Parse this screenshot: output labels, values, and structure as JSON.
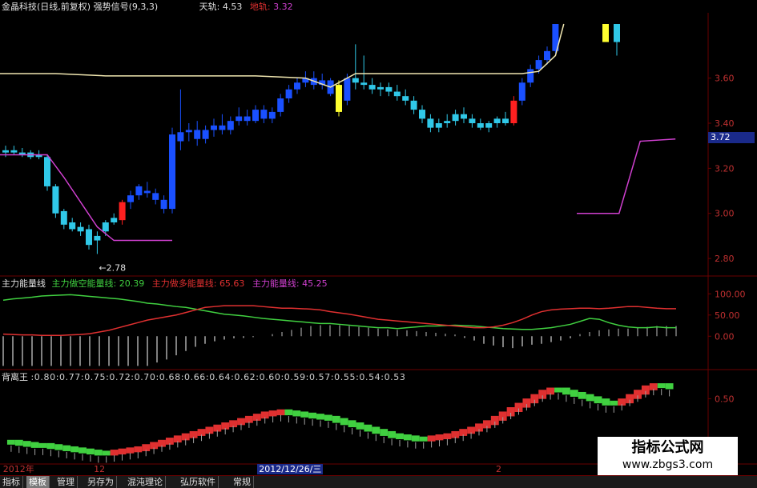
{
  "header": {
    "title": "金晶科技(日线,前复权)",
    "indicator": "强势信号(9,3,3)",
    "upper_label": "天轨:",
    "upper_value": "4.53",
    "lower_label": "地轨:",
    "lower_value": "3.32"
  },
  "colors": {
    "background": "#000000",
    "up_candle": "#ff2020",
    "down_candle": "#30c8e8",
    "strong_bar": "#1a50ff",
    "yellow_signal": "#ffff30",
    "upper_line": "#f0e6b0",
    "lower_line": "#d040d0",
    "energy_green": "#40d040",
    "energy_red": "#e03030",
    "energy_magenta": "#d040d0",
    "axis_text": "#c03030",
    "grid": "#6a0000"
  },
  "chart_data": [
    {
      "type": "line",
      "name": "price",
      "yticks": [
        2.8,
        3.0,
        3.2,
        3.4,
        3.6
      ],
      "ylim": [
        2.74,
        3.84
      ],
      "current_price": "3.72",
      "low_annotation": "←2.78",
      "candles": [
        {
          "o": 3.28,
          "h": 3.3,
          "l": 3.25,
          "c": 3.27,
          "k": "d"
        },
        {
          "o": 3.28,
          "h": 3.3,
          "l": 3.26,
          "c": 3.27,
          "k": "d"
        },
        {
          "o": 3.27,
          "h": 3.29,
          "l": 3.25,
          "c": 3.26,
          "k": "d"
        },
        {
          "o": 3.27,
          "h": 3.28,
          "l": 3.24,
          "c": 3.25,
          "k": "d"
        },
        {
          "o": 3.26,
          "h": 3.28,
          "l": 3.24,
          "c": 3.25,
          "k": "d"
        },
        {
          "o": 3.25,
          "h": 3.26,
          "l": 3.1,
          "c": 3.12,
          "k": "d"
        },
        {
          "o": 3.12,
          "h": 3.13,
          "l": 2.98,
          "c": 3.0,
          "k": "d"
        },
        {
          "o": 3.01,
          "h": 3.02,
          "l": 2.93,
          "c": 2.95,
          "k": "d"
        },
        {
          "o": 2.96,
          "h": 2.98,
          "l": 2.92,
          "c": 2.93,
          "k": "d"
        },
        {
          "o": 2.94,
          "h": 2.96,
          "l": 2.9,
          "c": 2.92,
          "k": "d"
        },
        {
          "o": 2.93,
          "h": 2.95,
          "l": 2.84,
          "c": 2.86,
          "k": "d"
        },
        {
          "o": 2.88,
          "h": 2.92,
          "l": 2.82,
          "c": 2.9,
          "k": "d"
        },
        {
          "o": 2.92,
          "h": 2.97,
          "l": 2.9,
          "c": 2.96,
          "k": "d"
        },
        {
          "o": 2.96,
          "h": 3.0,
          "l": 2.95,
          "c": 2.98,
          "k": "d"
        },
        {
          "o": 2.97,
          "h": 3.06,
          "l": 2.95,
          "c": 3.05,
          "k": "u"
        },
        {
          "o": 3.05,
          "h": 3.1,
          "l": 3.02,
          "c": 3.08,
          "k": "b"
        },
        {
          "o": 3.08,
          "h": 3.13,
          "l": 3.06,
          "c": 3.12,
          "k": "b"
        },
        {
          "o": 3.1,
          "h": 3.14,
          "l": 3.07,
          "c": 3.09,
          "k": "b"
        },
        {
          "o": 3.09,
          "h": 3.11,
          "l": 3.04,
          "c": 3.06,
          "k": "b"
        },
        {
          "o": 3.06,
          "h": 3.08,
          "l": 3.0,
          "c": 3.02,
          "k": "b"
        },
        {
          "o": 3.02,
          "h": 3.38,
          "l": 3.0,
          "c": 3.35,
          "k": "b"
        },
        {
          "o": 3.32,
          "h": 3.55,
          "l": 3.28,
          "c": 3.36,
          "k": "b"
        },
        {
          "o": 3.36,
          "h": 3.4,
          "l": 3.32,
          "c": 3.37,
          "k": "b"
        },
        {
          "o": 3.37,
          "h": 3.41,
          "l": 3.3,
          "c": 3.33,
          "k": "b"
        },
        {
          "o": 3.33,
          "h": 3.39,
          "l": 3.31,
          "c": 3.37,
          "k": "b"
        },
        {
          "o": 3.37,
          "h": 3.42,
          "l": 3.34,
          "c": 3.39,
          "k": "b"
        },
        {
          "o": 3.39,
          "h": 3.44,
          "l": 3.35,
          "c": 3.37,
          "k": "b"
        },
        {
          "o": 3.37,
          "h": 3.43,
          "l": 3.35,
          "c": 3.41,
          "k": "b"
        },
        {
          "o": 3.41,
          "h": 3.47,
          "l": 3.39,
          "c": 3.43,
          "k": "b"
        },
        {
          "o": 3.43,
          "h": 3.46,
          "l": 3.39,
          "c": 3.41,
          "k": "b"
        },
        {
          "o": 3.41,
          "h": 3.48,
          "l": 3.4,
          "c": 3.46,
          "k": "b"
        },
        {
          "o": 3.46,
          "h": 3.48,
          "l": 3.4,
          "c": 3.42,
          "k": "b"
        },
        {
          "o": 3.42,
          "h": 3.47,
          "l": 3.4,
          "c": 3.45,
          "k": "b"
        },
        {
          "o": 3.45,
          "h": 3.53,
          "l": 3.43,
          "c": 3.51,
          "k": "b"
        },
        {
          "o": 3.51,
          "h": 3.57,
          "l": 3.49,
          "c": 3.55,
          "k": "b"
        },
        {
          "o": 3.55,
          "h": 3.6,
          "l": 3.53,
          "c": 3.58,
          "k": "b"
        },
        {
          "o": 3.58,
          "h": 3.63,
          "l": 3.56,
          "c": 3.6,
          "k": "b"
        },
        {
          "o": 3.6,
          "h": 3.63,
          "l": 3.55,
          "c": 3.57,
          "k": "b"
        },
        {
          "o": 3.57,
          "h": 3.62,
          "l": 3.55,
          "c": 3.59,
          "k": "b"
        },
        {
          "o": 3.59,
          "h": 3.6,
          "l": 3.52,
          "c": 3.53,
          "k": "b"
        },
        {
          "o": 3.57,
          "h": 3.59,
          "l": 3.43,
          "c": 3.45,
          "k": "y"
        },
        {
          "o": 3.5,
          "h": 3.62,
          "l": 3.48,
          "c": 3.6,
          "k": "b"
        },
        {
          "o": 3.6,
          "h": 3.75,
          "l": 3.55,
          "c": 3.58,
          "k": "d"
        },
        {
          "o": 3.58,
          "h": 3.7,
          "l": 3.55,
          "c": 3.57,
          "k": "d"
        },
        {
          "o": 3.57,
          "h": 3.6,
          "l": 3.53,
          "c": 3.55,
          "k": "d"
        },
        {
          "o": 3.55,
          "h": 3.58,
          "l": 3.52,
          "c": 3.56,
          "k": "d"
        },
        {
          "o": 3.56,
          "h": 3.58,
          "l": 3.52,
          "c": 3.54,
          "k": "d"
        },
        {
          "o": 3.54,
          "h": 3.57,
          "l": 3.5,
          "c": 3.52,
          "k": "d"
        },
        {
          "o": 3.52,
          "h": 3.55,
          "l": 3.48,
          "c": 3.5,
          "k": "d"
        },
        {
          "o": 3.5,
          "h": 3.52,
          "l": 3.44,
          "c": 3.46,
          "k": "d"
        },
        {
          "o": 3.46,
          "h": 3.48,
          "l": 3.4,
          "c": 3.42,
          "k": "d"
        },
        {
          "o": 3.42,
          "h": 3.44,
          "l": 3.36,
          "c": 3.38,
          "k": "d"
        },
        {
          "o": 3.38,
          "h": 3.42,
          "l": 3.36,
          "c": 3.4,
          "k": "d"
        },
        {
          "o": 3.4,
          "h": 3.44,
          "l": 3.38,
          "c": 3.41,
          "k": "d"
        },
        {
          "o": 3.41,
          "h": 3.46,
          "l": 3.39,
          "c": 3.44,
          "k": "d"
        },
        {
          "o": 3.44,
          "h": 3.47,
          "l": 3.4,
          "c": 3.42,
          "k": "d"
        },
        {
          "o": 3.42,
          "h": 3.44,
          "l": 3.38,
          "c": 3.4,
          "k": "d"
        },
        {
          "o": 3.4,
          "h": 3.42,
          "l": 3.37,
          "c": 3.38,
          "k": "d"
        },
        {
          "o": 3.38,
          "h": 3.41,
          "l": 3.36,
          "c": 3.4,
          "k": "d"
        },
        {
          "o": 3.4,
          "h": 3.43,
          "l": 3.38,
          "c": 3.42,
          "k": "d"
        },
        {
          "o": 3.42,
          "h": 3.45,
          "l": 3.39,
          "c": 3.4,
          "k": "d"
        },
        {
          "o": 3.4,
          "h": 3.52,
          "l": 3.39,
          "c": 3.5,
          "k": "u"
        },
        {
          "o": 3.5,
          "h": 3.6,
          "l": 3.48,
          "c": 3.58,
          "k": "b"
        },
        {
          "o": 3.58,
          "h": 3.66,
          "l": 3.56,
          "c": 3.64,
          "k": "b"
        },
        {
          "o": 3.64,
          "h": 3.7,
          "l": 3.62,
          "c": 3.68,
          "k": "b"
        },
        {
          "o": 3.68,
          "h": 3.74,
          "l": 3.66,
          "c": 3.72,
          "k": "b"
        },
        {
          "o": 3.72,
          "h": 3.84,
          "l": 3.71,
          "c": 3.84,
          "k": "b"
        }
      ],
      "gap_after": 66,
      "tail_candles": [
        {
          "o": 3.84,
          "h": 3.84,
          "l": 3.76,
          "c": 3.76,
          "k": "y"
        },
        {
          "o": 3.76,
          "h": 3.84,
          "l": 3.7,
          "c": 3.84,
          "k": "d"
        }
      ],
      "upper_rail": [
        [
          0,
          3.62
        ],
        [
          6,
          3.62
        ],
        [
          12,
          3.61
        ],
        [
          18,
          3.61
        ],
        [
          24,
          3.61
        ],
        [
          30,
          3.61
        ],
        [
          36,
          3.6
        ],
        [
          39,
          3.56
        ],
        [
          42,
          3.62
        ],
        [
          46,
          3.62
        ],
        [
          52,
          3.62
        ],
        [
          58,
          3.62
        ],
        [
          62,
          3.62
        ],
        [
          64,
          3.63
        ],
        [
          66,
          3.7
        ],
        [
          67,
          3.84
        ]
      ],
      "lower_rail": [
        [
          0,
          3.26
        ],
        [
          5,
          3.26
        ],
        [
          7,
          3.16
        ],
        [
          9,
          3.05
        ],
        [
          11,
          2.94
        ],
        [
          13,
          2.88
        ],
        [
          15,
          2.88
        ],
        [
          20,
          2.88
        ]
      ],
      "lower_rail_right": [
        [
          0,
          3.0
        ],
        [
          6,
          3.0
        ],
        [
          9,
          3.32
        ],
        [
          14,
          3.33
        ]
      ]
    },
    {
      "type": "line",
      "name": "energy",
      "legend_title": "主力能量线",
      "legend": [
        {
          "label": "主力做空能量线:",
          "value": "20.39",
          "color": "#40d040"
        },
        {
          "label": "主力做多能量线:",
          "value": "65.63",
          "color": "#e03030"
        },
        {
          "label": "主力能量线:",
          "value": "45.25",
          "color": "#d040d0"
        }
      ],
      "yticks": [
        0.0,
        50.0,
        100.0
      ],
      "ylim": [
        -75,
        110
      ],
      "green": [
        85,
        88,
        90,
        92,
        95,
        96,
        97,
        98,
        96,
        94,
        92,
        90,
        88,
        85,
        82,
        78,
        76,
        73,
        70,
        68,
        64,
        60,
        56,
        52,
        50,
        48,
        45,
        42,
        40,
        38,
        36,
        34,
        32,
        30,
        30,
        28,
        26,
        24,
        22,
        20,
        20,
        18,
        20,
        22,
        24,
        24,
        25,
        26,
        25,
        24,
        22,
        20,
        18,
        17,
        16,
        16,
        18,
        20,
        24,
        28,
        35,
        42,
        40,
        32,
        26,
        22,
        20,
        20,
        22,
        20,
        20
      ],
      "red": [
        5,
        4,
        3,
        3,
        2,
        2,
        2,
        3,
        4,
        6,
        10,
        14,
        20,
        26,
        32,
        38,
        42,
        46,
        50,
        56,
        62,
        68,
        70,
        72,
        72,
        72,
        72,
        70,
        68,
        66,
        66,
        65,
        64,
        62,
        58,
        55,
        52,
        48,
        44,
        40,
        38,
        36,
        34,
        32,
        30,
        28,
        26,
        24,
        22,
        20,
        20,
        22,
        26,
        32,
        40,
        50,
        58,
        62,
        64,
        65,
        66,
        66,
        65,
        66,
        68,
        70,
        70,
        68,
        66,
        65,
        65
      ],
      "bars": [
        -70,
        -70,
        -70,
        -70,
        -70,
        -70,
        -70,
        -70,
        -70,
        -70,
        -70,
        -70,
        -70,
        -70,
        -70,
        -70,
        -62,
        -55,
        -45,
        -35,
        -25,
        -18,
        -12,
        -8,
        -5,
        -4,
        -2,
        0,
        5,
        10,
        15,
        20,
        24,
        26,
        26,
        26,
        24,
        22,
        20,
        18,
        16,
        15,
        14,
        12,
        10,
        8,
        6,
        4,
        -4,
        -10,
        -18,
        -22,
        -26,
        -28,
        -24,
        -20,
        -18,
        -14,
        -10,
        -5,
        5,
        10,
        14,
        16,
        18,
        18,
        20,
        22,
        24,
        24,
        24
      ]
    },
    {
      "type": "line",
      "name": "divergence",
      "legend_title": "背离王",
      "sequence": ":0.80:0.77:0.75:0.72:0.70:0.68:0.66:0.64:0.62:0.60:0.59:0.57:0.55:0.54:0.53",
      "yticks": [
        0.5
      ],
      "ylim": [
        -0.1,
        0.65
      ],
      "values": [
        0.1,
        0.1,
        0.09,
        0.08,
        0.07,
        0.07,
        0.06,
        0.05,
        0.04,
        0.03,
        0.02,
        0.01,
        0.0,
        0.0,
        0.01,
        0.02,
        0.03,
        0.04,
        0.06,
        0.08,
        0.1,
        0.12,
        0.14,
        0.16,
        0.18,
        0.2,
        0.22,
        0.24,
        0.26,
        0.28,
        0.3,
        0.32,
        0.34,
        0.36,
        0.37,
        0.38,
        0.37,
        0.36,
        0.35,
        0.34,
        0.33,
        0.32,
        0.3,
        0.28,
        0.26,
        0.24,
        0.22,
        0.2,
        0.18,
        0.16,
        0.15,
        0.14,
        0.13,
        0.13,
        0.14,
        0.15,
        0.16,
        0.18,
        0.2,
        0.22,
        0.25,
        0.28,
        0.32,
        0.36,
        0.4,
        0.44,
        0.48,
        0.52,
        0.56,
        0.58,
        0.58,
        0.56,
        0.54,
        0.52,
        0.5,
        0.48,
        0.46,
        0.46,
        0.48,
        0.52,
        0.56,
        0.6,
        0.62,
        0.62,
        0.61
      ]
    }
  ],
  "time_axis": {
    "labels": [
      {
        "text": "2012年",
        "pos": 0.004
      },
      {
        "text": "12",
        "pos": 0.124
      },
      {
        "text": "2012/12/26/三",
        "pos": 0.34
      },
      {
        "text": "2",
        "pos": 0.655
      }
    ]
  },
  "tabs": [
    {
      "label": "指标",
      "active": false
    },
    {
      "label": "模板",
      "active": true
    },
    {
      "label": "管理",
      "active": false
    },
    {
      "label": "另存为",
      "active": false
    },
    {
      "label": "混沌理论",
      "active": false
    },
    {
      "label": "弘历软件",
      "active": false
    },
    {
      "label": "常规",
      "active": false
    }
  ],
  "watermark": {
    "title": "指标公式网",
    "url": "www.zbgs3.com"
  }
}
